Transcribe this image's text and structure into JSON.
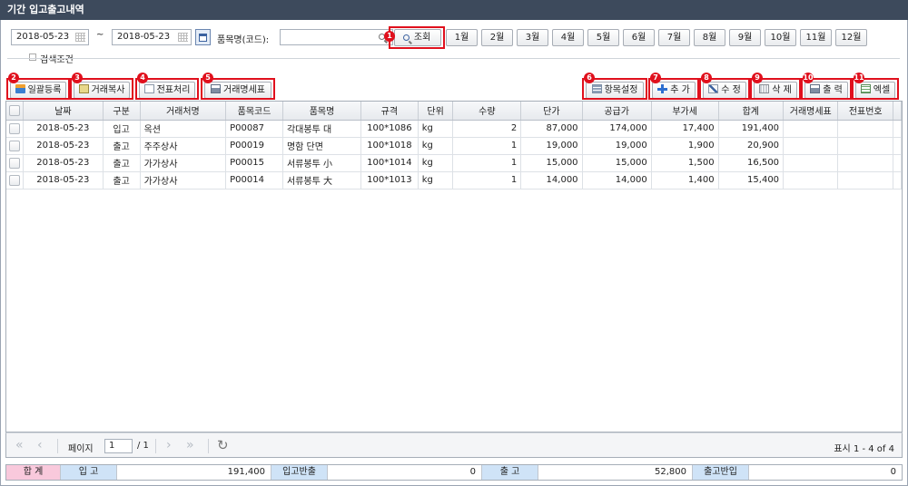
{
  "window": {
    "title": "기간 입고출고내역"
  },
  "search": {
    "date_from": "2018-05-23",
    "date_to": "2018-05-23",
    "range_sep": "~",
    "product_label": "품목명(코드):",
    "product_value": "",
    "query_button": "조회",
    "months": [
      "1월",
      "2월",
      "3월",
      "4월",
      "5월",
      "6월",
      "7월",
      "8월",
      "9월",
      "10월",
      "11월",
      "12월"
    ],
    "condition_label": "검색조건"
  },
  "toolbar_left": [
    {
      "badge": "2",
      "label": "일괄등록",
      "icon": "upload-icon"
    },
    {
      "badge": "3",
      "label": "거래복사",
      "icon": "copy-icon"
    },
    {
      "badge": "4",
      "label": "전표처리",
      "icon": "document-icon"
    },
    {
      "badge": "5",
      "label": "거래명세표",
      "icon": "printer-icon"
    }
  ],
  "toolbar_right": [
    {
      "badge": "6",
      "label": "항목설정",
      "icon": "settings-icon"
    },
    {
      "badge": "7",
      "label": "추 가",
      "icon": "plus-icon"
    },
    {
      "badge": "8",
      "label": "수 정",
      "icon": "edit-icon"
    },
    {
      "badge": "9",
      "label": "삭 제",
      "icon": "trash-icon"
    },
    {
      "badge": "10",
      "label": "출 력",
      "icon": "printer-icon"
    },
    {
      "badge": "11",
      "label": "엑셀",
      "icon": "excel-icon"
    }
  ],
  "query_badge": "1",
  "table": {
    "columns": [
      "날짜",
      "구분",
      "거래처명",
      "품목코드",
      "품목명",
      "규격",
      "단위",
      "수량",
      "단가",
      "공급가",
      "부가세",
      "합계",
      "거래명세표",
      "전표번호"
    ],
    "rows": [
      [
        "2018-05-23",
        "입고",
        "옥션",
        "P00087",
        "각대봉투 대",
        "100*1086",
        "kg",
        "2",
        "87,000",
        "174,000",
        "17,400",
        "191,400",
        "",
        ""
      ],
      [
        "2018-05-23",
        "출고",
        "주주상사",
        "P00019",
        "명함 단면",
        "100*1018",
        "kg",
        "1",
        "19,000",
        "19,000",
        "1,900",
        "20,900",
        "",
        ""
      ],
      [
        "2018-05-23",
        "출고",
        "가가상사",
        "P00015",
        "서류봉투 小",
        "100*1014",
        "kg",
        "1",
        "15,000",
        "15,000",
        "1,500",
        "16,500",
        "",
        ""
      ],
      [
        "2018-05-23",
        "출고",
        "가가상사",
        "P00014",
        "서류봉투 大",
        "100*1013",
        "kg",
        "1",
        "14,000",
        "14,000",
        "1,400",
        "15,400",
        "",
        ""
      ]
    ]
  },
  "pager": {
    "page_label": "페이지",
    "page_value": "1",
    "total_pages": "/ 1",
    "display": "표시 1 - 4 of 4"
  },
  "footer": {
    "total_label": "합 계",
    "in_label": "입 고",
    "in_value": "191,400",
    "in_return_label": "입고반출",
    "in_return_value": "0",
    "out_label": "출 고",
    "out_value": "52,800",
    "out_return_label": "출고반입",
    "out_return_value": "0"
  },
  "colors": {
    "titlebar": "#3d4a5c",
    "highlight": "#e0101d",
    "total_bg": "#f9c9dc",
    "label_bg": "#cfe3f7"
  }
}
